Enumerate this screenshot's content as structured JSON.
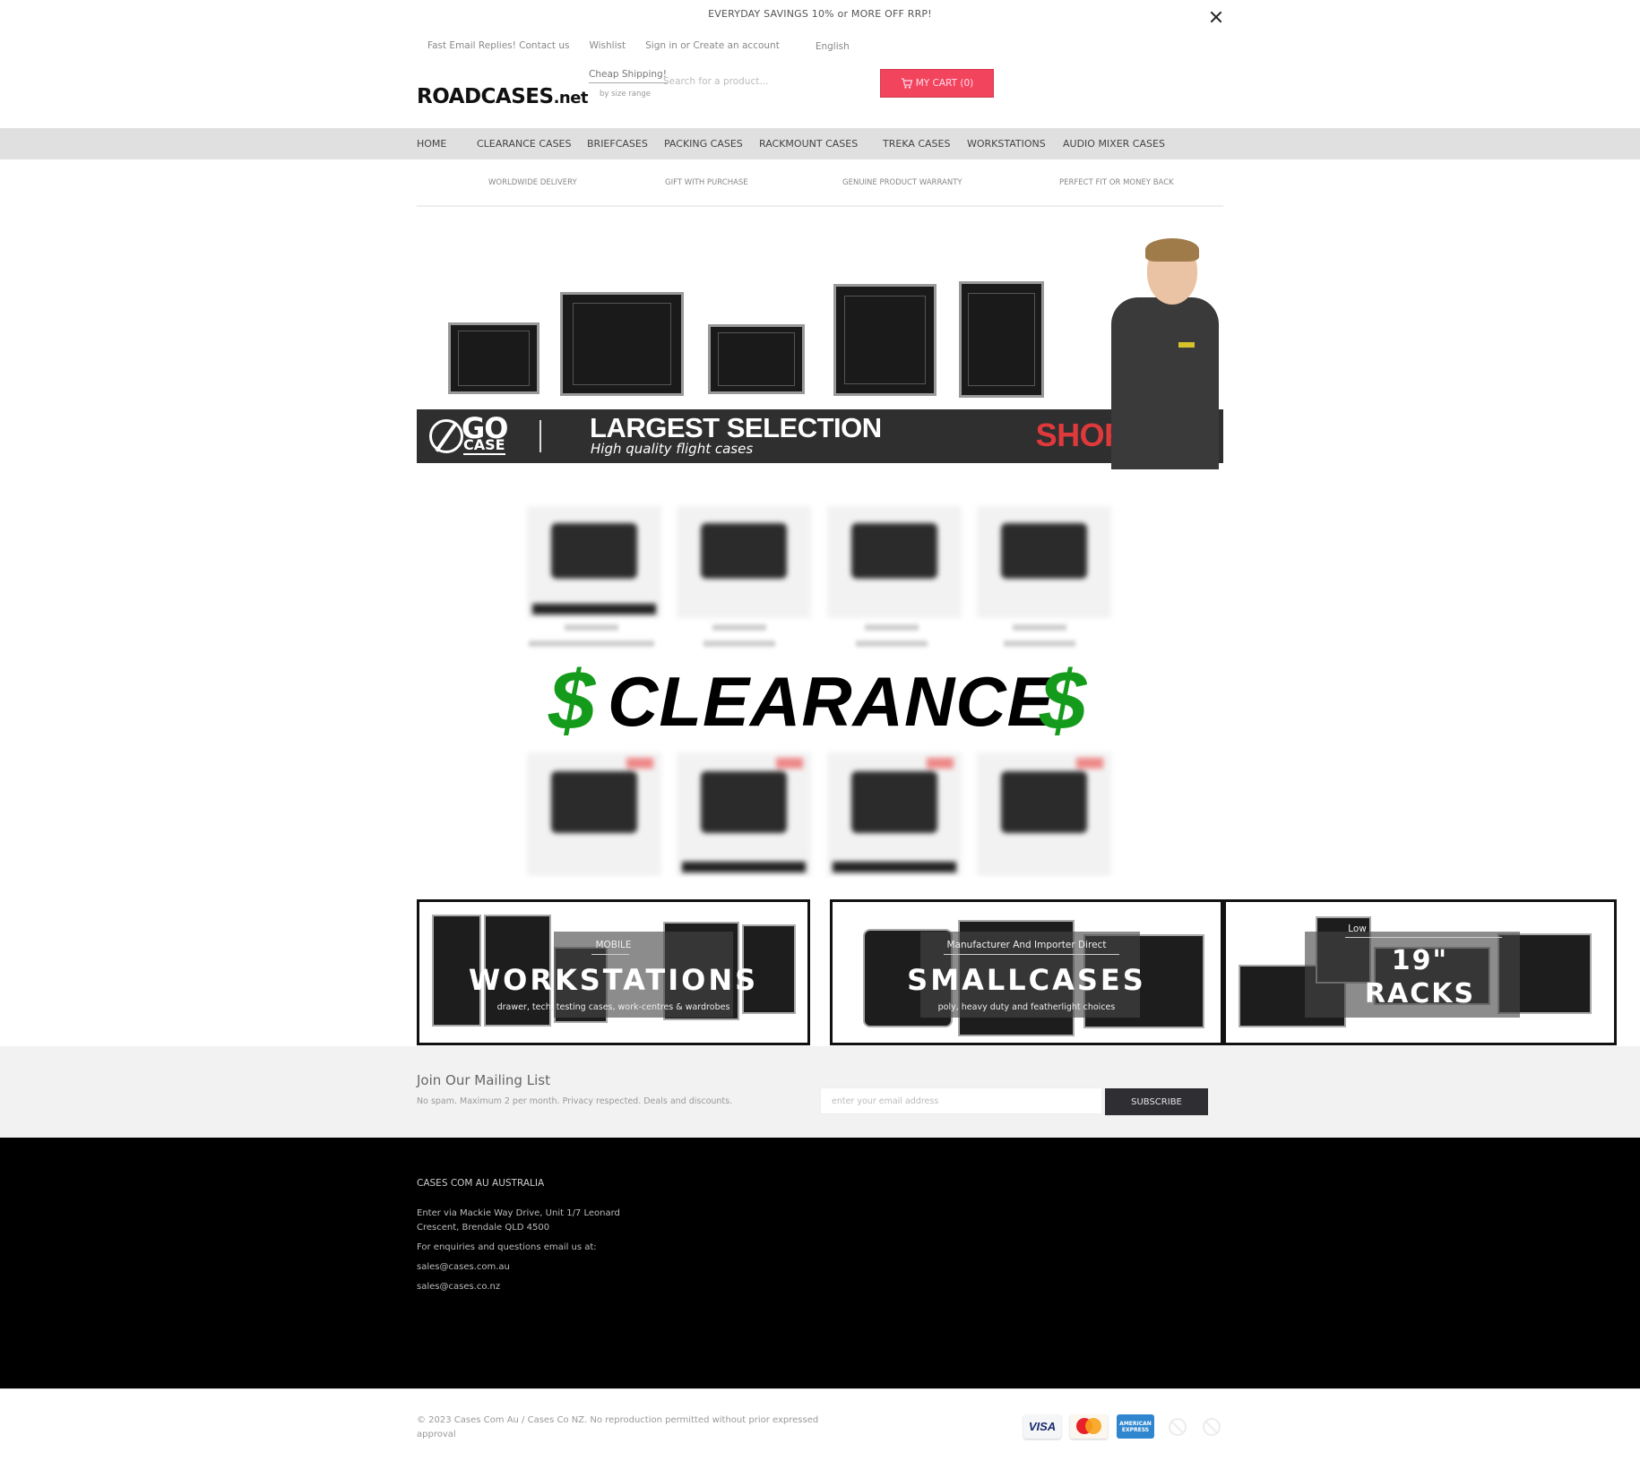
{
  "announcement": "EVERYDAY SAVINGS 10% or MORE OFF RRP!",
  "close_icon": "close-icon",
  "top_links": {
    "contact": "Fast Email Replies! Contact us",
    "wishlist": "Wishlist",
    "account": "Sign in or Create an account",
    "language": "English"
  },
  "logo": {
    "main": "ROADCASES",
    "suffix": ".net"
  },
  "shipping": {
    "label": "Cheap Shipping!",
    "sub": "by size range"
  },
  "search": {
    "placeholder": "Search for a product...",
    "value": ""
  },
  "cart": {
    "label": "MY CART (0)",
    "icon": "cart-icon",
    "color": "#f2445c"
  },
  "nav": [
    {
      "label": "HOME"
    },
    {
      "label": "CLEARANCE CASES"
    },
    {
      "label": "BRIEFCASES"
    },
    {
      "label": "PACKING CASES"
    },
    {
      "label": "RACKMOUNT CASES"
    },
    {
      "label": "TREKA CASES"
    },
    {
      "label": "WORKSTATIONS"
    },
    {
      "label": "AUDIO MIXER CASES"
    }
  ],
  "perks": [
    {
      "label": "WORLDWIDE DELIVERY"
    },
    {
      "label": "GIFT WITH PURCHASE"
    },
    {
      "label": "GENUINE PRODUCT WARRANTY"
    },
    {
      "label": "PERFECT FIT OR MONEY BACK"
    }
  ],
  "hero": {
    "brand_top": "GO",
    "brand_bottom": "CASE",
    "title": "LARGEST SELECTION",
    "subtitle": "High quality flight cases",
    "cta": "SHOP NOW",
    "cta_color": "#e0393c"
  },
  "clearance_banner": {
    "symbol": "$",
    "text": "CLEARANCE",
    "symbol_color": "#159b1b"
  },
  "categories": [
    {
      "kicker": "MOBILE",
      "title": "WORKSTATIONS",
      "desc": "drawer, tech, testing cases, work-centres & wardrobes"
    },
    {
      "kicker": "Manufacturer And Importer Direct",
      "title": "SMALLCASES",
      "desc": "poly, heavy duty and featherlight choices"
    },
    {
      "kicker": "Low",
      "title": "19\" RACKS",
      "title_line1": "19\"",
      "title_line2": "RACKS",
      "desc": ""
    }
  ],
  "mailing": {
    "title": "Join Our Mailing List",
    "subtitle": "No spam. Maximum 2 per month. Privacy respected. Deals and discounts.",
    "placeholder": "enter your email address",
    "button": "SUBSCRIBE"
  },
  "footer": {
    "heading": "CASES COM AU AUSTRALIA",
    "address_line1": "Enter via Mackie Way Drive, Unit 1/7 Leonard",
    "address_line2": "Crescent, Brendale QLD 4500",
    "enquiries": "For enquiries and questions email us at:",
    "email_au": "sales@cases.com.au",
    "email_nz": "sales@cases.co.nz"
  },
  "bottom": {
    "copyright": "© 2023 Cases Com Au / Cases Co NZ. No reproduction permitted without prior expressed approval",
    "payments": [
      {
        "name": "visa",
        "label": "VISA"
      },
      {
        "name": "mastercard",
        "label": "MasterCard"
      },
      {
        "name": "american-express",
        "label": "AMERICAN EXPRESS"
      },
      {
        "name": "unavailable-1",
        "label": ""
      },
      {
        "name": "unavailable-2",
        "label": ""
      }
    ]
  }
}
